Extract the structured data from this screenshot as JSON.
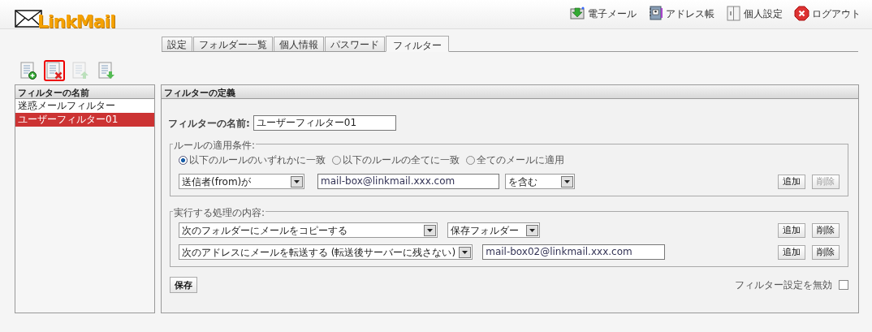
{
  "logo": {
    "text": "LinkMail"
  },
  "top_nav": [
    {
      "kind": "mail",
      "label": "電子メール"
    },
    {
      "kind": "addressbook",
      "label": "アドレス帳"
    },
    {
      "kind": "settings",
      "label": "個人設定"
    },
    {
      "kind": "logout",
      "label": "ログアウト"
    }
  ],
  "tabs": [
    {
      "label": "設定",
      "selected": false
    },
    {
      "label": "フォルダー一覧",
      "selected": false
    },
    {
      "label": "個人情報",
      "selected": false
    },
    {
      "label": "パスワード",
      "selected": false
    },
    {
      "label": "フィルター",
      "selected": true
    }
  ],
  "toolbar": [
    {
      "kind": "add",
      "disabled": false,
      "highlighted": false
    },
    {
      "kind": "delete",
      "disabled": false,
      "highlighted": true
    },
    {
      "kind": "up",
      "disabled": true,
      "highlighted": false
    },
    {
      "kind": "down",
      "disabled": false,
      "highlighted": false
    }
  ],
  "filter_list": {
    "title": "フィルターの名前",
    "items": [
      {
        "label": "迷惑メールフィルター",
        "selected": false
      },
      {
        "label": "ユーザーフィルター01",
        "selected": true
      }
    ]
  },
  "definition": {
    "title": "フィルターの定義",
    "name_label": "フィルターの名前:",
    "name_value": "ユーザーフィルター01",
    "conditions": {
      "legend": "ルールの適用条件:",
      "options": [
        {
          "label": "以下のルールのいずれかに一致",
          "selected": true
        },
        {
          "label": "以下のルールの全てに一致",
          "selected": false
        },
        {
          "label": "全てのメールに適用",
          "selected": false
        }
      ],
      "rules": [
        {
          "field": "送信者(from)が",
          "value": "mail-box@linkmail.xxx.com",
          "operator": "を含む",
          "add_button": {
            "label": "追加",
            "disabled": false
          },
          "delete_button": {
            "label": "削除",
            "disabled": true
          }
        }
      ]
    },
    "actions": {
      "legend": "実行する処理の内容:",
      "rows": [
        {
          "kind": "select",
          "action": "次のフォルダーにメールをコピーする",
          "target": "保存フォルダー",
          "add_button": {
            "label": "追加",
            "disabled": false
          },
          "delete_button": {
            "label": "削除",
            "disabled": false
          }
        },
        {
          "kind": "input",
          "action": "次のアドレスにメールを転送する (転送後サーバーに残さない)",
          "target": "mail-box02@linkmail.xxx.com",
          "add_button": {
            "label": "追加",
            "disabled": false
          },
          "delete_button": {
            "label": "削除",
            "disabled": false
          }
        }
      ]
    },
    "save_button": "保存",
    "disable_label": "フィルター設定を無効",
    "disable_checked": false
  }
}
